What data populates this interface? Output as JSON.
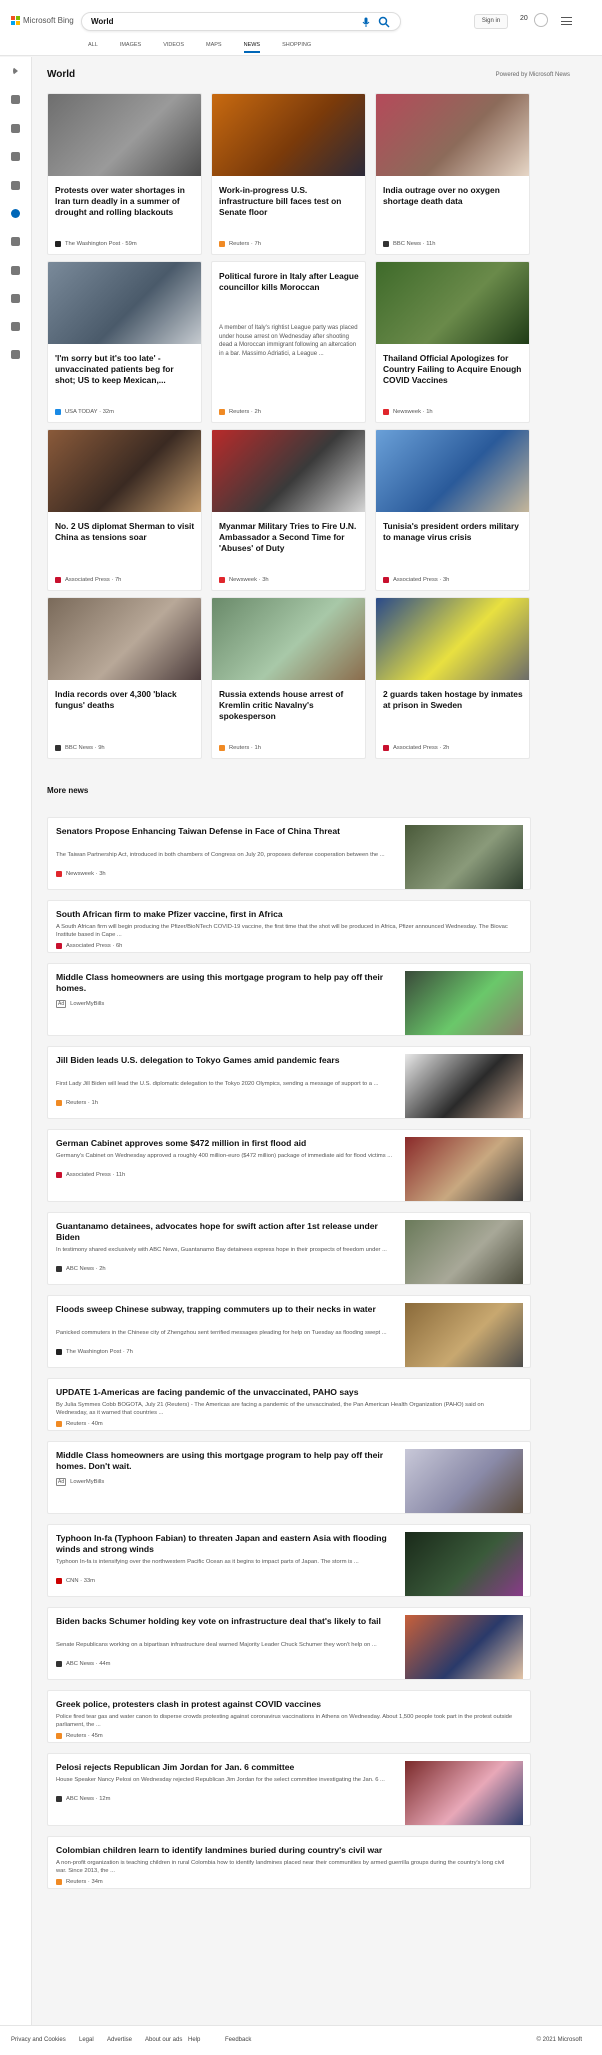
{
  "header": {
    "brand": "Microsoft Bing",
    "query": "World",
    "signin": "Sign in",
    "rewards_count": "20"
  },
  "tabs": [
    "ALL",
    "IMAGES",
    "VIDEOS",
    "MAPS",
    "NEWS",
    "SHOPPING"
  ],
  "section": {
    "title": "World",
    "powered": "Powered by Microsoft News"
  },
  "cards": [
    {
      "title": "Protests over water shortages in Iran turn deadly in a summer of drought and rolling blackouts",
      "source": "The Washington Post",
      "time": "59m",
      "src_color": "#222",
      "img": [
        "#6e6e6e",
        "#9a9a9a",
        "#4b4b4b"
      ]
    },
    {
      "title": "Work-in-progress U.S. infrastructure bill faces test on Senate floor",
      "source": "Reuters",
      "time": "7h",
      "src_color": "#f08a24",
      "img": [
        "#c86a10",
        "#7a3a0a",
        "#2a2a3a"
      ]
    },
    {
      "title": "India outrage over no oxygen shortage death data",
      "source": "BBC News",
      "time": "11h",
      "src_color": "#333",
      "img": [
        "#b54a5a",
        "#8c6b5a",
        "#e8d8c8"
      ]
    },
    {
      "title": "'I'm sorry but it's too late' - unvaccinated patients beg for shot; US to keep Mexican,...",
      "source": "USA TODAY",
      "time": "32m",
      "src_color": "#1a8ae5",
      "img": [
        "#7a8a9a",
        "#4a5a6a",
        "#c8cdd2"
      ]
    },
    {
      "title": "Political furore in Italy after League councillor kills Moroccan",
      "abstract": "A member of Italy's rightist League party was placed under house arrest on Wednesday after shooting dead a Moroccan immigrant following an altercation in a bar. Massimo Adriatici, a League ...",
      "source": "Reuters",
      "time": "2h",
      "src_color": "#f08a24"
    },
    {
      "title": "Thailand Official Apologizes for Country Failing to Acquire Enough COVID Vaccines",
      "source": "Newsweek",
      "time": "1h",
      "src_color": "#e0262c",
      "img": [
        "#3e6a2a",
        "#6a8a4a",
        "#1e3a16"
      ]
    },
    {
      "title": "No. 2 US diplomat Sherman to visit China as tensions soar",
      "source": "Associated Press",
      "time": "7h",
      "src_color": "#c8102e",
      "img": [
        "#8a5a3a",
        "#3a2a22",
        "#c8a070"
      ]
    },
    {
      "title": "Myanmar Military Tries to Fire U.N. Ambassador a Second Time for 'Abuses' of Duty",
      "source": "Newsweek",
      "time": "3h",
      "src_color": "#e0262c",
      "img": [
        "#b82a2a",
        "#3a3a3a",
        "#d8d8d8"
      ]
    },
    {
      "title": "Tunisia's president orders military to manage virus crisis",
      "source": "Associated Press",
      "time": "3h",
      "src_color": "#c8102e",
      "img": [
        "#6aa0d8",
        "#2a5a9a",
        "#c8b89a"
      ]
    },
    {
      "title": "India records over 4,300 'black fungus' deaths",
      "source": "BBC News",
      "time": "9h",
      "src_color": "#333",
      "img": [
        "#7a6a5a",
        "#b8a898",
        "#4a3a3a"
      ]
    },
    {
      "title": "Russia extends house arrest of Kremlin critic Navalny's spokesperson",
      "source": "Reuters",
      "time": "1h",
      "src_color": "#f08a24",
      "img": [
        "#6a8a6a",
        "#a8c8a8",
        "#8a6a4a"
      ]
    },
    {
      "title": "2 guards taken hostage by inmates at prison in Sweden",
      "source": "Associated Press",
      "time": "2h",
      "src_color": "#c8102e",
      "img": [
        "#2a4a8a",
        "#e8e040",
        "#6a6a6a"
      ]
    }
  ],
  "more_news": {
    "title": "More news",
    "items": [
      {
        "title": "Senators Propose Enhancing Taiwan Defense in Face of China Threat",
        "desc": "The Taiwan Partnership Act, introduced in both chambers of Congress on July 20, proposes defense cooperation between the ...",
        "source": "Newsweek",
        "time": "3h",
        "src_color": "#e0262c",
        "img": [
          "#4a5a3a",
          "#8a9a7a",
          "#2a3a2a"
        ]
      },
      {
        "title": "South African firm to make Pfizer vaccine, first in Africa",
        "desc": "A South African firm will begin producing the Pfizer/BioNTech COVID-19 vaccine, the first time that the shot will be produced in Africa, Pfizer announced Wednesday. The Biovac Institute based in Cape ...",
        "source": "Associated Press",
        "time": "6h",
        "src_color": "#c8102e"
      },
      {
        "title": "Middle Class homeowners are using this mortgage program to help pay off their homes.",
        "desc": "",
        "ad": "Ad",
        "source": "LowerMyBills",
        "time": "",
        "img": [
          "#3a4a3a",
          "#6ac86a",
          "#8a7a6a"
        ]
      },
      {
        "title": "Jill Biden leads U.S. delegation to Tokyo Games amid pandemic fears",
        "desc": "First Lady Jill Biden will lead the U.S. diplomatic delegation to the Tokyo 2020 Olympics, sending a message of support to a ...",
        "source": "Reuters",
        "time": "1h",
        "src_color": "#f08a24",
        "img": [
          "#e8e8e8",
          "#2a2a2a",
          "#c8a890"
        ]
      },
      {
        "title": "German Cabinet approves some $472 million in first flood aid",
        "desc": "Germany's Cabinet on Wednesday approved a roughly 400 million-euro ($472 million) package of immediate aid for flood victims ...",
        "source": "Associated Press",
        "time": "11h",
        "src_color": "#c8102e",
        "img": [
          "#8a2a2a",
          "#c8a880",
          "#3a3a3a"
        ]
      },
      {
        "title": "Guantanamo detainees, advocates hope for swift action after 1st release under Biden",
        "desc": "In testimony shared exclusively with ABC News, Guantanamo Bay detainees express hope in their prospects of freedom under ...",
        "source": "ABC News",
        "time": "2h",
        "src_color": "#333",
        "img": [
          "#6a7a5a",
          "#a8a898",
          "#4a4a3a"
        ]
      },
      {
        "title": "Floods sweep Chinese subway, trapping commuters up to their necks in water",
        "desc": "Panicked commuters in the Chinese city of Zhengzhou sent terrified messages pleading for help on Tuesday as flooding swept ...",
        "source": "The Washington Post",
        "time": "7h",
        "src_color": "#222",
        "img": [
          "#8a6a3a",
          "#c8a870",
          "#4a4a4a"
        ]
      },
      {
        "title": "UPDATE 1-Americas are facing pandemic of the unvaccinated, PAHO says",
        "desc": "By Julia Symmes Cobb BOGOTA, July 21 (Reuters) - The Americas are facing a pandemic of the unvaccinated, the Pan American Health Organization (PAHO) said on Wednesday, as it warned that countries ...",
        "source": "Reuters",
        "time": "40m",
        "src_color": "#f08a24"
      },
      {
        "title": "Middle Class homeowners are using this mortgage program to help pay off their homes. Don't wait.",
        "desc": "",
        "ad": "Ad",
        "source": "LowerMyBills",
        "time": "",
        "img": [
          "#c8c8d8",
          "#8a8aa8",
          "#5a4a3a"
        ]
      },
      {
        "title": "Typhoon In-fa (Typhoon Fabian) to threaten Japan and eastern Asia with flooding winds and strong winds",
        "desc": "Typhoon In-fa is intensifying over the northwestern Pacific Ocean as it begins to impact parts of Japan. The storm is ...",
        "source": "CNN",
        "time": "33m",
        "src_color": "#cc0000",
        "img": [
          "#1a2a1a",
          "#3a5a3a",
          "#8a3a8a"
        ]
      },
      {
        "title": "Biden backs Schumer holding key vote on infrastructure deal that's likely to fail",
        "desc": "Senate Republicans working on a bipartisan infrastructure deal warned Majority Leader Chuck Schumer they won't help on ...",
        "source": "ABC News",
        "time": "44m",
        "src_color": "#333",
        "img": [
          "#c8603a",
          "#2a3a6a",
          "#e8c8a8"
        ]
      },
      {
        "title": "Greek police, protesters clash in protest against COVID vaccines",
        "desc": "Police fired tear gas and water canon to disperse crowds protesting against coronavirus vaccinations in Athens on Wednesday. About 1,500 people took part in the protest outside parliament, the ...",
        "source": "Reuters",
        "time": "45m",
        "src_color": "#f08a24"
      },
      {
        "title": "Pelosi rejects Republican Jim Jordan for Jan. 6 committee",
        "desc": "House Speaker Nancy Pelosi on Wednesday rejected Republican Jim Jordan for the select committee investigating the Jan. 6 ...",
        "source": "ABC News",
        "time": "12m",
        "src_color": "#333",
        "img": [
          "#7a2a2a",
          "#e8a8b8",
          "#2a3a6a"
        ]
      },
      {
        "title": "Colombian children learn to identify landmines buried during country's civil war",
        "desc": "A non-profit organization is teaching children in rural Colombia how to identify landmines placed near their communities by armed guerrilla groups during the country's long civil war. Since 2013, the ...",
        "source": "Reuters",
        "time": "34m",
        "src_color": "#f08a24"
      }
    ]
  },
  "footer": {
    "links": [
      "Privacy and Cookies",
      "Legal",
      "Advertise",
      "About our ads",
      "Help",
      "Feedback"
    ],
    "copyright": "© 2021 Microsoft"
  },
  "side_icons": [
    "expand-icon",
    "home-icon",
    "tools-icon",
    "flag-icon",
    "location-icon",
    "globe-icon",
    "science-icon",
    "rocket-icon",
    "tv-icon",
    "building-icon",
    "wallet-icon"
  ]
}
